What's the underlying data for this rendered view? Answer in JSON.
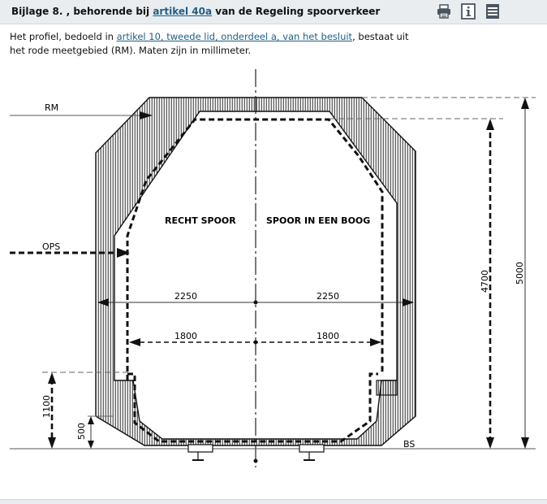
{
  "header": {
    "title_prefix": "Bijlage 8. , behorende bij ",
    "title_link": "artikel 40a",
    "title_suffix": " van de Regeling spoorverkeer",
    "icons": [
      "print-icon",
      "info-icon",
      "menu-icon"
    ]
  },
  "intro": {
    "text_1": "Het profiel, bedoeld in ",
    "link": "artikel 10, tweede lid, onderdeel a, van het besluit",
    "text_2": ", bestaat uit",
    "text_3": "het rode meetgebied (RM). Maten zijn in millimeter."
  },
  "figure": {
    "label_rm": "RM",
    "label_ops": "OPS",
    "label_bs": "BS",
    "label_left": "RECHT SPOOR",
    "label_right": "SPOOR IN EEN BOOG",
    "dim_2250_left": "2250",
    "dim_2250_right": "2250",
    "dim_1800_left": "1800",
    "dim_1800_right": "1800",
    "dim_4700": "4700",
    "dim_5000": "5000",
    "dim_1100": "1100",
    "dim_500": "500"
  },
  "colors": {
    "link": "#1f5f86",
    "header_bg": "#e9edf0"
  }
}
